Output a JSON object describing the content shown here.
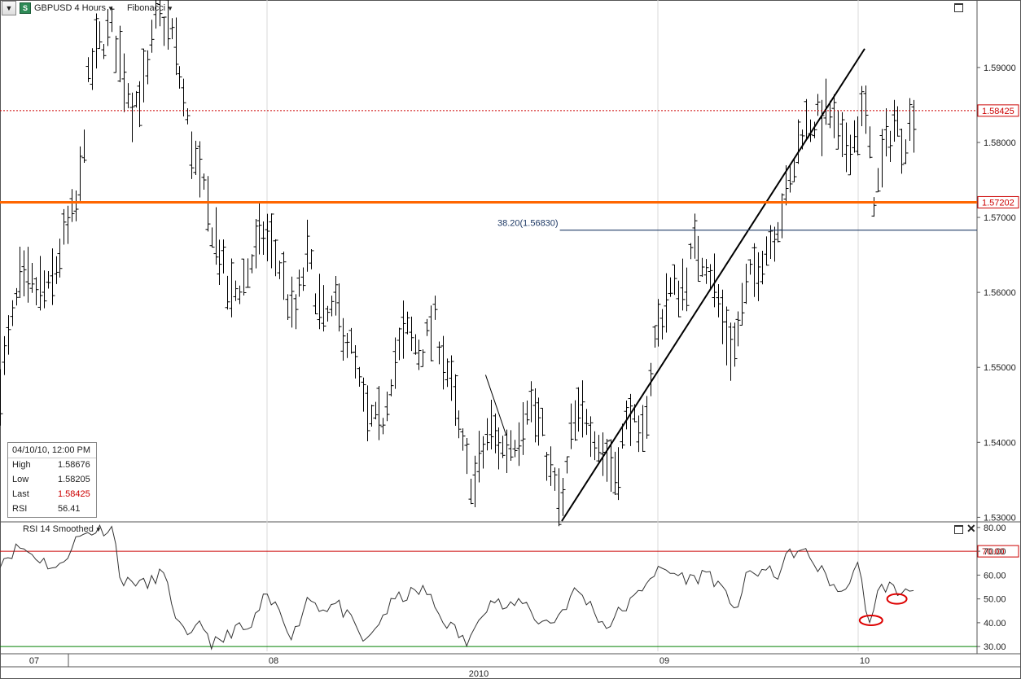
{
  "toolbar": {
    "symbol": "GBPUSD 4 Hours",
    "study": "Fibonacci",
    "symbol_icon": "S"
  },
  "colors": {
    "price_bar": "#000000",
    "resistance": "#ff6600",
    "dotted_last": "#cc0000",
    "fib_line": "#1f3a66",
    "rsi_line": "#333333",
    "rsi_70": "#cc0000",
    "rsi_30": "#008000",
    "annotation": "#dd0000"
  },
  "info_box": {
    "datetime": "04/10/10, 12:00 PM",
    "rows": [
      {
        "label": "High",
        "value": "1.58676"
      },
      {
        "label": "Low",
        "value": "1.58205"
      },
      {
        "label": "Last",
        "value": "1.58425"
      },
      {
        "label": "RSI",
        "value": "56.41"
      }
    ]
  },
  "indicator": {
    "label": "RSI 14 Smoothed"
  },
  "chart_data": {
    "type": "ohlc",
    "price_axis": {
      "ylim": [
        1.5295,
        1.599
      ],
      "ticks": [
        "1.59000",
        "1.58000",
        "1.57000",
        "1.56000",
        "1.55000",
        "1.54000",
        "1.53000"
      ],
      "tick_values": [
        1.59,
        1.58,
        1.57,
        1.56,
        1.55,
        1.54,
        1.53
      ]
    },
    "rsi_axis": {
      "ylim": [
        28,
        82
      ],
      "ticks": [
        "80.00",
        "70.00",
        "60.00",
        "50.00",
        "40.00",
        "30.00"
      ],
      "tick_values": [
        80,
        70,
        60,
        50,
        40,
        30
      ]
    },
    "x_axis": {
      "labels": [
        "07",
        "08",
        "09",
        "10"
      ],
      "label_positions": [
        0.035,
        0.28,
        0.68,
        0.885
      ],
      "year_label": "2010",
      "year_position": 0.49
    },
    "levels": {
      "dotted_price": 1.58425,
      "dotted_price_label": "1.58425",
      "resistance": 1.57202,
      "resistance_label": "1.57202",
      "fib_level": 1.5683,
      "fib_label": "38.20(1.56830)",
      "rsi_upper": 70,
      "rsi_upper_label": "70.00",
      "rsi_lower": 30
    },
    "trendline": {
      "from": [
        0.575,
        1.5295
      ],
      "to": [
        0.885,
        1.5925
      ]
    },
    "price_anchors": [
      [
        0.0,
        1.548
      ],
      [
        0.02,
        1.561
      ],
      [
        0.05,
        1.56
      ],
      [
        0.065,
        1.567
      ],
      [
        0.08,
        1.572
      ],
      [
        0.09,
        1.588
      ],
      [
        0.1,
        1.593
      ],
      [
        0.115,
        1.595
      ],
      [
        0.125,
        1.59
      ],
      [
        0.135,
        1.585
      ],
      [
        0.15,
        1.588
      ],
      [
        0.16,
        1.597
      ],
      [
        0.175,
        1.595
      ],
      [
        0.185,
        1.588
      ],
      [
        0.195,
        1.58
      ],
      [
        0.21,
        1.572
      ],
      [
        0.225,
        1.565
      ],
      [
        0.235,
        1.559
      ],
      [
        0.25,
        1.562
      ],
      [
        0.27,
        1.568
      ],
      [
        0.285,
        1.564
      ],
      [
        0.3,
        1.556
      ],
      [
        0.315,
        1.565
      ],
      [
        0.33,
        1.556
      ],
      [
        0.345,
        1.558
      ],
      [
        0.36,
        1.552
      ],
      [
        0.375,
        1.543
      ],
      [
        0.39,
        1.542
      ],
      [
        0.4,
        1.549
      ],
      [
        0.415,
        1.555
      ],
      [
        0.43,
        1.552
      ],
      [
        0.445,
        1.556
      ],
      [
        0.46,
        1.548
      ],
      [
        0.475,
        1.538
      ],
      [
        0.485,
        1.534
      ],
      [
        0.5,
        1.542
      ],
      [
        0.515,
        1.539
      ],
      [
        0.53,
        1.541
      ],
      [
        0.54,
        1.546
      ],
      [
        0.555,
        1.541
      ],
      [
        0.565,
        1.535
      ],
      [
        0.575,
        1.531
      ],
      [
        0.585,
        1.542
      ],
      [
        0.6,
        1.544
      ],
      [
        0.615,
        1.539
      ],
      [
        0.63,
        1.536
      ],
      [
        0.645,
        1.545
      ],
      [
        0.655,
        1.538
      ],
      [
        0.67,
        1.554
      ],
      [
        0.685,
        1.56
      ],
      [
        0.7,
        1.561
      ],
      [
        0.71,
        1.566
      ],
      [
        0.725,
        1.564
      ],
      [
        0.74,
        1.556
      ],
      [
        0.75,
        1.552
      ],
      [
        0.765,
        1.561
      ],
      [
        0.78,
        1.565
      ],
      [
        0.795,
        1.569
      ],
      [
        0.81,
        1.575
      ],
      [
        0.82,
        1.582
      ],
      [
        0.835,
        1.583
      ],
      [
        0.85,
        1.584
      ],
      [
        0.86,
        1.579
      ],
      [
        0.875,
        1.581
      ],
      [
        0.885,
        1.585
      ],
      [
        0.895,
        1.572
      ],
      [
        0.905,
        1.579
      ],
      [
        0.915,
        1.583
      ],
      [
        0.925,
        1.58
      ],
      [
        0.935,
        1.584
      ]
    ],
    "rsi_anchors": [
      [
        0.0,
        66
      ],
      [
        0.02,
        72
      ],
      [
        0.04,
        67
      ],
      [
        0.06,
        62
      ],
      [
        0.075,
        74
      ],
      [
        0.09,
        78
      ],
      [
        0.1,
        79
      ],
      [
        0.115,
        80
      ],
      [
        0.125,
        56
      ],
      [
        0.14,
        58
      ],
      [
        0.15,
        55
      ],
      [
        0.165,
        62
      ],
      [
        0.175,
        50
      ],
      [
        0.185,
        37
      ],
      [
        0.195,
        32
      ],
      [
        0.205,
        42
      ],
      [
        0.215,
        32
      ],
      [
        0.225,
        31
      ],
      [
        0.24,
        38
      ],
      [
        0.255,
        36
      ],
      [
        0.27,
        50
      ],
      [
        0.285,
        46
      ],
      [
        0.3,
        34
      ],
      [
        0.315,
        51
      ],
      [
        0.33,
        46
      ],
      [
        0.345,
        48
      ],
      [
        0.36,
        40
      ],
      [
        0.375,
        31
      ],
      [
        0.39,
        42
      ],
      [
        0.405,
        50
      ],
      [
        0.42,
        52
      ],
      [
        0.435,
        54
      ],
      [
        0.45,
        43
      ],
      [
        0.47,
        35
      ],
      [
        0.48,
        30
      ],
      [
        0.49,
        44
      ],
      [
        0.505,
        50
      ],
      [
        0.52,
        45
      ],
      [
        0.535,
        50
      ],
      [
        0.55,
        41
      ],
      [
        0.565,
        40
      ],
      [
        0.575,
        45
      ],
      [
        0.59,
        54
      ],
      [
        0.605,
        47
      ],
      [
        0.62,
        38
      ],
      [
        0.635,
        45
      ],
      [
        0.65,
        50
      ],
      [
        0.665,
        60
      ],
      [
        0.68,
        62
      ],
      [
        0.695,
        60
      ],
      [
        0.71,
        58
      ],
      [
        0.725,
        62
      ],
      [
        0.74,
        52
      ],
      [
        0.755,
        47
      ],
      [
        0.765,
        60
      ],
      [
        0.78,
        62
      ],
      [
        0.795,
        60
      ],
      [
        0.81,
        70
      ],
      [
        0.825,
        69
      ],
      [
        0.84,
        62
      ],
      [
        0.855,
        55
      ],
      [
        0.865,
        51
      ],
      [
        0.87,
        60
      ],
      [
        0.88,
        64
      ],
      [
        0.885,
        44
      ],
      [
        0.89,
        42
      ],
      [
        0.9,
        54
      ],
      [
        0.91,
        56
      ],
      [
        0.918,
        52
      ],
      [
        0.926,
        54
      ],
      [
        0.935,
        56
      ]
    ],
    "last": {
      "high": 1.58676,
      "low": 1.58205,
      "last": 1.58425,
      "rsi": 56.41
    }
  }
}
